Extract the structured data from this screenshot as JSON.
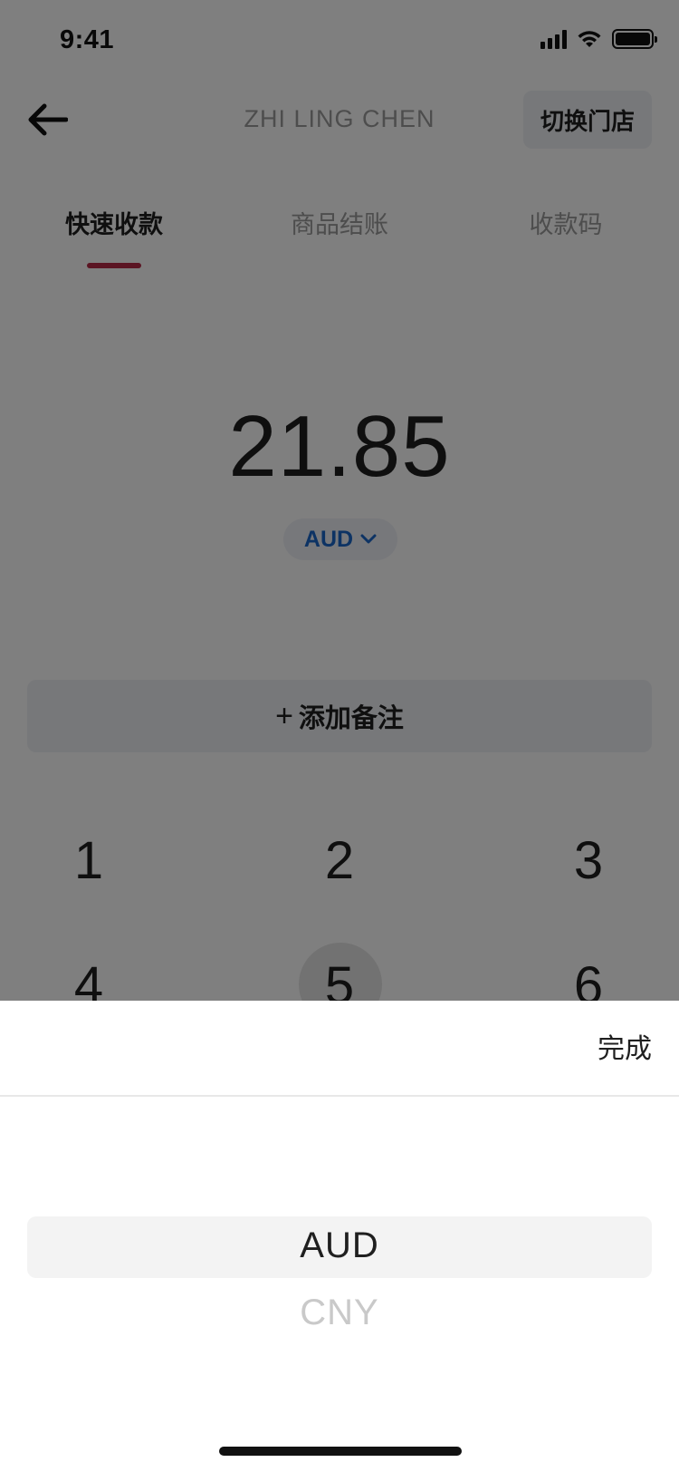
{
  "status_bar": {
    "time": "9:41"
  },
  "header": {
    "title": "ZHI LING CHEN",
    "switch_store_label": "切换门店"
  },
  "tabs": [
    {
      "label": "快速收款",
      "active": true
    },
    {
      "label": "商品结账",
      "active": false
    },
    {
      "label": "收款码",
      "active": false
    }
  ],
  "amount": {
    "value": "21.85",
    "currency": "AUD"
  },
  "remark": {
    "label": "添加备注"
  },
  "keypad": {
    "keys": [
      "1",
      "2",
      "3",
      "4",
      "5",
      "6"
    ]
  },
  "picker": {
    "done_label": "完成",
    "options": [
      "AUD",
      "CNY"
    ],
    "selected": "AUD"
  },
  "colors": {
    "accent": "#b72a47",
    "link": "#1a66c9"
  },
  "icons": {
    "back": "arrow-left-icon",
    "currency_dropdown": "chevron-down-icon"
  }
}
